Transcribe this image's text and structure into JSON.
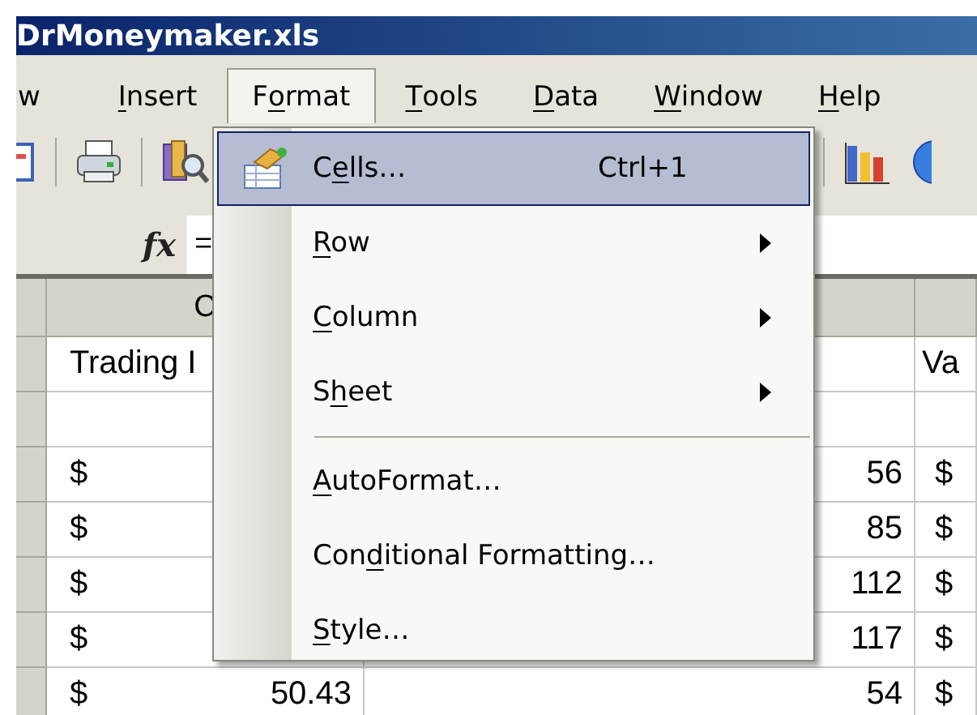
{
  "window": {
    "title": "DrMoneymaker.xls"
  },
  "menu_bar": [
    {
      "selected": false,
      "segments": [
        {
          "text": "w",
          "underlined": false
        }
      ]
    },
    {
      "selected": false,
      "segments": [
        {
          "text": "I",
          "underlined": true
        },
        {
          "text": "nsert",
          "underlined": false
        }
      ]
    },
    {
      "selected": true,
      "segments": [
        {
          "text": "F",
          "underlined": false
        },
        {
          "text": "o",
          "underlined": true
        },
        {
          "text": "rmat",
          "underlined": false
        }
      ]
    },
    {
      "selected": false,
      "segments": [
        {
          "text": "T",
          "underlined": true
        },
        {
          "text": "ools",
          "underlined": false
        }
      ]
    },
    {
      "selected": false,
      "segments": [
        {
          "text": "D",
          "underlined": true
        },
        {
          "text": "ata",
          "underlined": false
        }
      ]
    },
    {
      "selected": false,
      "segments": [
        {
          "text": "W",
          "underlined": true
        },
        {
          "text": "indow",
          "underlined": false
        }
      ]
    },
    {
      "selected": false,
      "segments": [
        {
          "text": "H",
          "underlined": true
        },
        {
          "text": "elp",
          "underlined": false
        }
      ]
    }
  ],
  "formula_bar": {
    "function_button": "fx",
    "content": "="
  },
  "grid": {
    "column_headers": [
      "C"
    ],
    "rows": [
      {
        "kind": "text",
        "column_c": "Trading I",
        "column_e": "Va"
      },
      {
        "kind": "blank"
      },
      {
        "kind": "currency",
        "column_c_symbol": "$",
        "column_d": "56",
        "column_e_symbol": "$"
      },
      {
        "kind": "currency",
        "column_c_symbol": "$",
        "column_d": "85",
        "column_e_symbol": "$"
      },
      {
        "kind": "currency",
        "column_c_symbol": "$",
        "column_d": "112",
        "column_e_symbol": "$"
      },
      {
        "kind": "currency",
        "column_c_symbol": "$",
        "column_d": "117",
        "column_e_symbol": "$"
      },
      {
        "kind": "currency",
        "column_c_symbol": "$",
        "column_c_amount": "50.43",
        "column_d": "54",
        "column_e_symbol": "$"
      }
    ]
  },
  "format_menu": [
    {
      "kind": "item",
      "selected": true,
      "has_icon": true,
      "submenu": false,
      "shortcut": "Ctrl+1",
      "segments": [
        {
          "text": "C",
          "underlined": false
        },
        {
          "text": "e",
          "underlined": true
        },
        {
          "text": "lls…",
          "underlined": false
        }
      ]
    },
    {
      "kind": "item",
      "selected": false,
      "has_icon": false,
      "submenu": true,
      "segments": [
        {
          "text": "R",
          "underlined": true
        },
        {
          "text": "ow",
          "underlined": false
        }
      ]
    },
    {
      "kind": "item",
      "selected": false,
      "has_icon": false,
      "submenu": true,
      "segments": [
        {
          "text": "C",
          "underlined": true
        },
        {
          "text": "olumn",
          "underlined": false
        }
      ]
    },
    {
      "kind": "item",
      "selected": false,
      "has_icon": false,
      "submenu": true,
      "segments": [
        {
          "text": "S",
          "underlined": false
        },
        {
          "text": "h",
          "underlined": true
        },
        {
          "text": "eet",
          "underlined": false
        }
      ]
    },
    {
      "kind": "separator"
    },
    {
      "kind": "item",
      "selected": false,
      "has_icon": false,
      "submenu": false,
      "segments": [
        {
          "text": "A",
          "underlined": true
        },
        {
          "text": "utoFormat…",
          "underlined": false
        }
      ]
    },
    {
      "kind": "item",
      "selected": false,
      "has_icon": false,
      "submenu": false,
      "segments": [
        {
          "text": "Con",
          "underlined": false
        },
        {
          "text": "d",
          "underlined": true
        },
        {
          "text": "itional Formatting…",
          "underlined": false
        }
      ]
    },
    {
      "kind": "item",
      "selected": false,
      "has_icon": false,
      "submenu": false,
      "segments": [
        {
          "text": "S",
          "underlined": true
        },
        {
          "text": "tyle…",
          "underlined": false
        }
      ]
    }
  ]
}
